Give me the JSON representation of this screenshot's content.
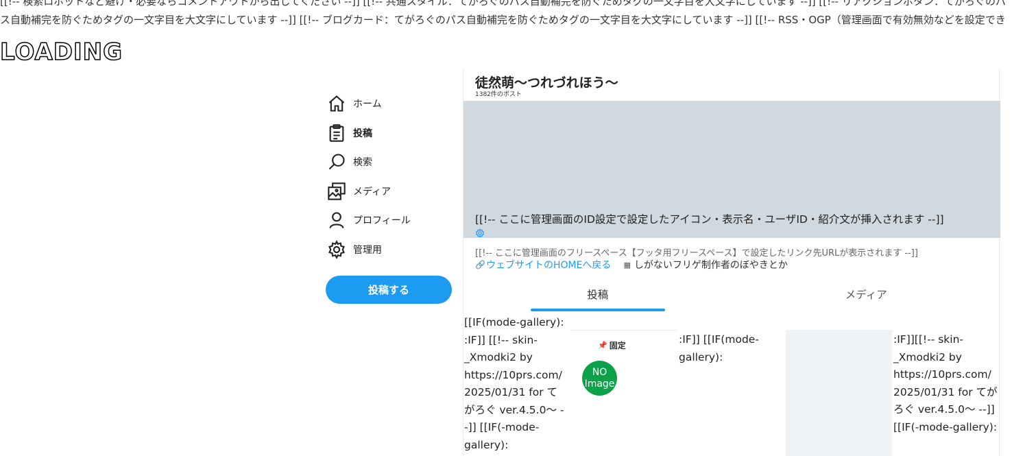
{
  "raw_comments": "[[!-- 検索ロボットなど避け・必要ならコメントアウトから出してください --]] [[!-- 共通スタイル：てがろぐのパス自動補完を防ぐためタグの一文字目を大文字にしています --]] [[!-- リアクションボタン：てがろぐのパス自動補完を防ぐためタグの一文字目を大文字にしています --]] [[!-- ブログカード：てがろぐのパス自動補完を防ぐためタグの一文字目を大文字にしています --]] [[!-- RSS・OGP（管理画面で有効無効などを設定できます） --]]",
  "loading_text": "LOADING",
  "sidebar": {
    "items": [
      {
        "label": "ホーム",
        "icon": "home-icon"
      },
      {
        "label": "投稿",
        "icon": "post-list-icon"
      },
      {
        "label": "検索",
        "icon": "search-icon"
      },
      {
        "label": "メディア",
        "icon": "media-icon"
      },
      {
        "label": "プロフィール",
        "icon": "profile-icon"
      },
      {
        "label": "管理用",
        "icon": "gear-icon"
      }
    ],
    "post_button": "投稿する"
  },
  "header": {
    "title": "徒然萌〜つれづれほう〜",
    "count": "1382件のポスト"
  },
  "profile": {
    "text": "[[!-- ここに管理画面のID設定で設定したアイコン・表示名・ユーザID・紹介文が挿入されます --]]",
    "free_space": "[[!-- ここに管理画面のフリースペース【フッタ用フリースペース】で設定したリンク先URLが表示されます --]]",
    "site_link_icon": "🔗",
    "site_link": "ウェブサイトのHOMEへ戻る",
    "calendar_icon": "▦",
    "blog_link": "しがないフリゲ制作者のぼやきとか"
  },
  "tabs": [
    {
      "label": "投稿",
      "active": true
    },
    {
      "label": "メディア",
      "active": false
    }
  ],
  "timeline": {
    "col1": "[[IF(mode-gallery): :IF]] [[!-- skin-_Xmodki2 by https://10prs.com/ 2025/01/31 for てがろぐ ver.4.5.0〜 --]] [[IF(-mode-gallery):",
    "pinned_label": "固定",
    "pin_icon": "📌",
    "noimage_line1": "NO",
    "noimage_line2": "Image",
    "col3": ":IF]] [[IF(mode-gallery):",
    "col5": ":IF]][[!-- skin-_Xmodki2 by https://10prs.com/ 2025/01/31 for てがろぐ ver.4.5.0〜 --]] [[IF(-mode-gallery):"
  },
  "colors": {
    "accent": "#1d9bf0",
    "banner": "#cfd9df",
    "noimage": "#0fa04a"
  }
}
